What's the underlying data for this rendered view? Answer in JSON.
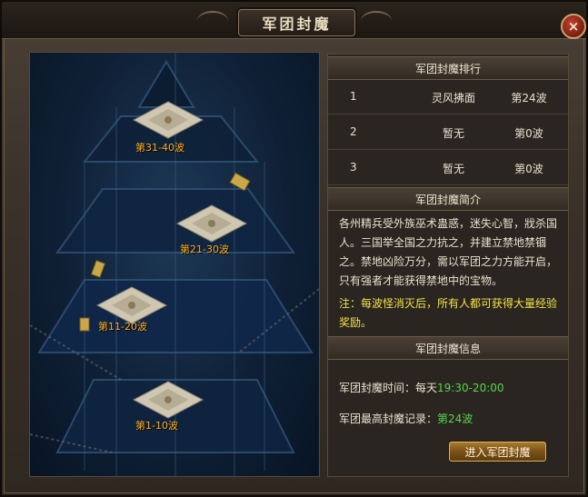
{
  "window": {
    "title": "军团封魔",
    "close_icon": "×"
  },
  "map": {
    "floors": [
      {
        "label": "第31-40波"
      },
      {
        "label": "第21-30波"
      },
      {
        "label": "第11-20波"
      },
      {
        "label": "第1-10波"
      }
    ]
  },
  "ranking": {
    "header": "军团封魔排行",
    "rows": [
      {
        "rank": "1",
        "guild": "灵风拂面",
        "wave": "第24波"
      },
      {
        "rank": "2",
        "guild": "暂无",
        "wave": "第0波"
      },
      {
        "rank": "3",
        "guild": "暂无",
        "wave": "第0波"
      }
    ]
  },
  "intro": {
    "header": "军团封魔简介",
    "text": "各州精兵受外族巫术蛊惑，迷失心智，戕杀国人。三国举全国之力抗之，并建立禁地禁锢之。禁地凶险万分，需以军团之力方能开启，只有强者才能获得禁地中的宝物。",
    "note": "注：每波怪消灭后，所有人都可获得大量经验奖励。"
  },
  "info": {
    "header": "军团封魔信息",
    "time_label": "军团封魔时间：每天",
    "time_value": "19:30-20:00",
    "record_label": "军团最高封魔记录：",
    "record_value": "第24波",
    "enter_button": "进入军团封魔"
  },
  "colors": {
    "accent_gold": "#ffb020",
    "highlight_green": "#56d64a",
    "note_yellow": "#f2e24a"
  }
}
